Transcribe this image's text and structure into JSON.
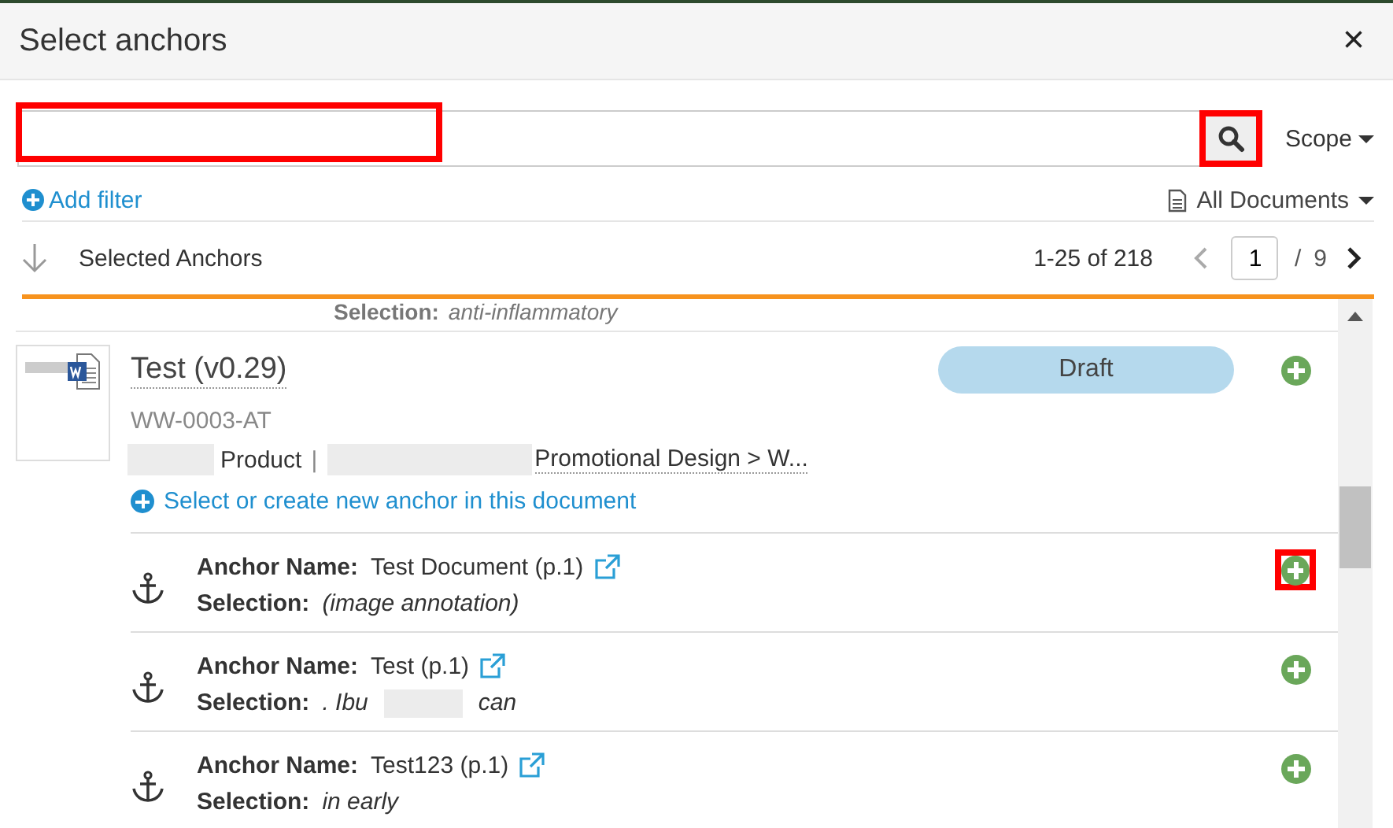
{
  "window": {
    "title": "Select anchors",
    "close": "×"
  },
  "search": {
    "highlighted": true,
    "button_highlighted": true,
    "scope": "Scope"
  },
  "filter": {
    "add_label": "Add filter",
    "documents": "All Documents"
  },
  "selected_bar": {
    "label": "Selected Anchors",
    "range": "1-25 of 218",
    "page": "1",
    "separator": "/",
    "pages": "9"
  },
  "prev_row": {
    "label": "Selection:",
    "value": "anti-inflammatory"
  },
  "document": {
    "title": "Test (v0.29)",
    "number": "WW-0003-AT",
    "status": "Draft",
    "path": [
      "Product",
      "Promotional Design > W..."
    ],
    "path_separator": "|",
    "create_link": "Select or create new anchor in this document",
    "anchors": [
      {
        "name_label": "Anchor Name:",
        "name": "Test Document (p.1)",
        "selection_label": "Selection:",
        "selection": [
          "(image annotation)"
        ],
        "highlighted": true
      },
      {
        "name_label": "Anchor Name:",
        "name": "Test (p.1)",
        "selection_label": "Selection:",
        "selection": [
          ". Ibu",
          "can"
        ],
        "highlighted": false
      },
      {
        "name_label": "Anchor Name:",
        "name": "Test123 (p.1)",
        "selection_label": "Selection:",
        "selection": [
          "in early"
        ],
        "highlighted": false
      }
    ]
  }
}
